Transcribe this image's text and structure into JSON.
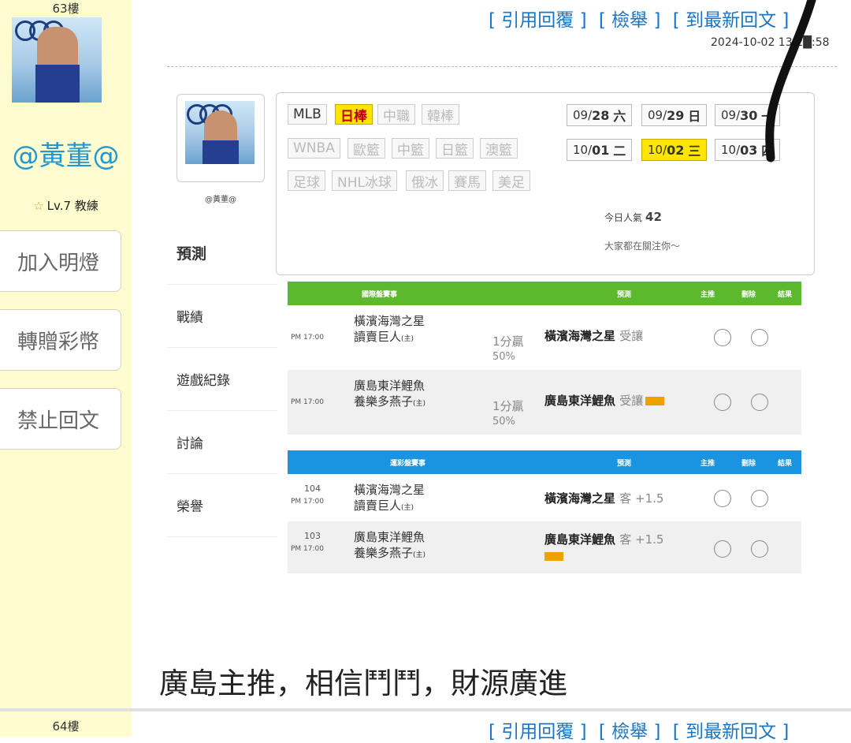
{
  "post63": {
    "floor": "63樓",
    "username": "@黃董@",
    "level": "Lv.7 教練",
    "buttons": [
      "加入明燈",
      "轉贈彩幣",
      "禁止回文"
    ],
    "actions": [
      "[ 引用回覆 ]",
      "[ 檢舉 ]",
      "[ 到最新回文 ]"
    ],
    "timestamp": "2024-10-02 13:2█:58",
    "comment": "廣島主推，相信鬥鬥，財源廣進"
  },
  "screenshot": {
    "profile_name": "@黃董@",
    "tabs": [
      "預測",
      "戰績",
      "遊戲紀錄",
      "討論",
      "榮譽"
    ],
    "active_tab": "預測",
    "sports_row1": [
      "MLB",
      "日棒",
      "中職",
      "韓棒"
    ],
    "sports_row2": [
      "WNBA",
      "歐籃",
      "中籃",
      "日籃",
      "澳籃"
    ],
    "sports_row3": [
      "足球",
      "NHL冰球",
      "俄冰",
      "賽馬",
      "美足"
    ],
    "selected_sport": "日棒",
    "dates": [
      {
        "md": "09/",
        "d": "28",
        "w": "六"
      },
      {
        "md": "09/",
        "d": "29",
        "w": "日"
      },
      {
        "md": "09/",
        "d": "30",
        "w": "一"
      },
      {
        "md": "10/",
        "d": "01",
        "w": "二"
      },
      {
        "md": "10/",
        "d": "02",
        "w": "三"
      },
      {
        "md": "10/",
        "d": "03",
        "w": "四"
      }
    ],
    "selected_date": "10/02",
    "popularity_label": "今日人氣",
    "popularity_value": "42",
    "hot_text": "大家都在關注你〜",
    "section1": {
      "title": "國際盤賽事",
      "headers": [
        "預測",
        "主推",
        "刪除",
        "結果"
      ],
      "color": "#5cb82d",
      "rows": [
        {
          "time": "PM 17:00",
          "away": "橫濱海灣之星",
          "home": "讀賣巨人",
          "home_tag": "(主)",
          "handicap": "1分贏",
          "pct": "50%",
          "pick": "橫濱海灣之星",
          "pick_type": "受讓",
          "badge": false
        },
        {
          "time": "PM 17:00",
          "away": "廣島東洋鯉魚",
          "home": "養樂多燕子",
          "home_tag": "(主)",
          "handicap": "1分贏",
          "pct": "50%",
          "pick": "廣島東洋鯉魚",
          "pick_type": "受讓",
          "badge": true
        }
      ]
    },
    "section2": {
      "title": "運彩盤賽事",
      "headers": [
        "預測",
        "主推",
        "刪除",
        "結果"
      ],
      "color": "#1a94e0",
      "rows": [
        {
          "num": "104",
          "time": "PM 17:00",
          "away": "橫濱海灣之星",
          "home": "讀賣巨人",
          "home_tag": "(主)",
          "pick": "橫濱海灣之星",
          "pick_type": "客 +1.5",
          "badge": false
        },
        {
          "num": "103",
          "time": "PM 17:00",
          "away": "廣島東洋鯉魚",
          "home": "養樂多燕子",
          "home_tag": "(主)",
          "pick": "廣島東洋鯉魚",
          "pick_type": "客 +1.5",
          "badge": true
        }
      ]
    }
  },
  "post64": {
    "floor": "64樓",
    "actions": [
      "[ 引用回覆 ]",
      "[ 檢舉 ]",
      "[ 到最新回文 ]"
    ]
  }
}
